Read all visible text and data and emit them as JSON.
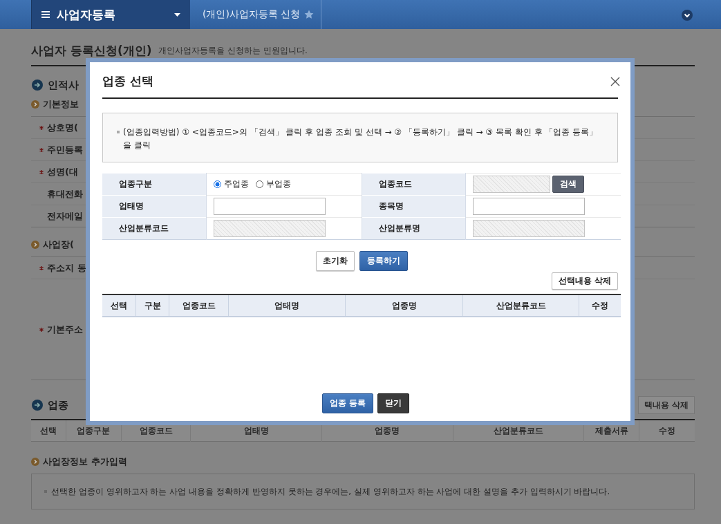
{
  "nav": {
    "menu_title": "사업자등록",
    "breadcrumb": "(개인)사업자등록 신청",
    "favorite": false
  },
  "background": {
    "title": "사업자 등록신청(개인)",
    "subtitle": "개인사업자등록을 신청하는 민원입니다.",
    "personal_heading": "인적사",
    "basic_heading": "기본정보",
    "basic_rows": [
      {
        "label": "상호명(",
        "required": true
      },
      {
        "label": "주민등록",
        "required": true
      },
      {
        "label": "성명(대",
        "required": true
      },
      {
        "label": "휴대전화",
        "required": false
      },
      {
        "label": "전자메일",
        "required": false
      }
    ],
    "business_heading": "사업장(",
    "business_rows": [
      {
        "label": "주소지 동",
        "required": true,
        "tall": false
      },
      {
        "label": "기본주소",
        "required": true,
        "tall": true
      }
    ],
    "industry_heading": "업종",
    "delete_button": "택내용 삭제",
    "table_columns": [
      "선택",
      "업종구분",
      "업종코드",
      "업태명",
      "업종명",
      "산업분류코드",
      "제출서류",
      "수정"
    ],
    "extra_heading": "사업장정보 추가입력",
    "extra_note": "선택한 업종이 영위하고자 하는 사업 내용을 정확하게 반영하지 못하는 경우에는, 실제 영위하고자 하는 사업에 대한 설명을 추가 입력하시기 바랍니다."
  },
  "dialog": {
    "title": "업종 선택",
    "guide": "(업종입력방법) ① <업종코드>의 「검색」 클릭 후 업종 조회 및 선택 → ② 「등록하기」 클릭 → ③ 목록 확인 후 「업종 등록」을 클릭",
    "form_rows": [
      [
        {
          "label": "업종구분",
          "kind": "radio",
          "options": [
            {
              "label": "주업종",
              "selected": true
            },
            {
              "label": "부업종",
              "selected": false
            }
          ]
        },
        {
          "label": "업종코드",
          "kind": "search",
          "disabled": true,
          "button": "검색"
        }
      ],
      [
        {
          "label": "업태명",
          "kind": "text",
          "disabled": false
        },
        {
          "label": "종목명",
          "kind": "text",
          "disabled": false
        }
      ],
      [
        {
          "label": "산업분류코드",
          "kind": "text",
          "disabled": true
        },
        {
          "label": "산업분류명",
          "kind": "text",
          "disabled": true
        }
      ]
    ],
    "reset_button": "초기화",
    "add_button": "등록하기",
    "delete_button": "선택내용 삭제",
    "table_columns": [
      "선택",
      "구분",
      "업종코드",
      "업태명",
      "업종명",
      "산업분류코드",
      "수정"
    ],
    "register_button": "업종 등록",
    "close_button": "닫기"
  }
}
